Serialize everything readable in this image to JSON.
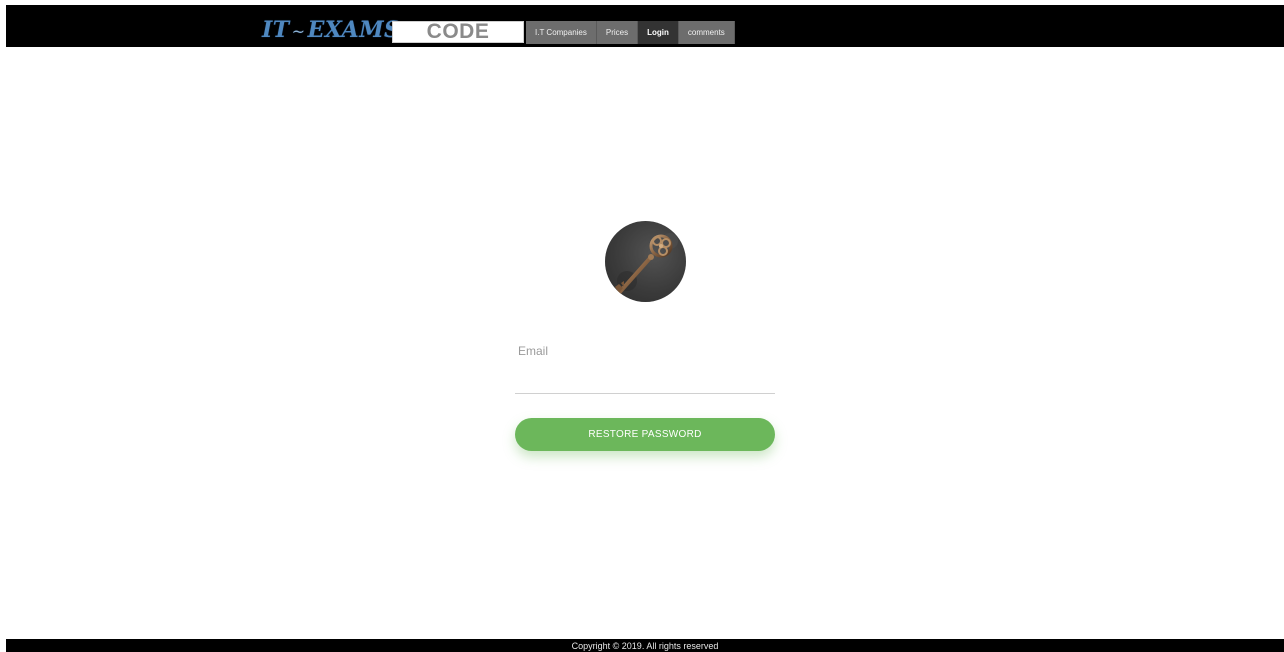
{
  "header": {
    "logo_left": "IT",
    "logo_sep": "~",
    "logo_right": "EXAMS",
    "code_label": "CODE",
    "nav": [
      {
        "label": "I.T Companies",
        "active": false
      },
      {
        "label": "Prices",
        "active": false
      },
      {
        "label": "Login",
        "active": true
      },
      {
        "label": "comments",
        "active": false
      }
    ]
  },
  "form": {
    "avatar_icon": "key-icon",
    "email_label": "Email",
    "email_value": "",
    "restore_button_label": "RESTORE PASSWORD"
  },
  "footer": {
    "copyright": "Copyright © 2019. All rights reserved"
  },
  "colors": {
    "header_bg": "#000000",
    "nav_bg": "#6d6d6d",
    "nav_active_bg": "#333333",
    "button_green": "#6cb75b",
    "logo_blue": "#4f88c0"
  }
}
